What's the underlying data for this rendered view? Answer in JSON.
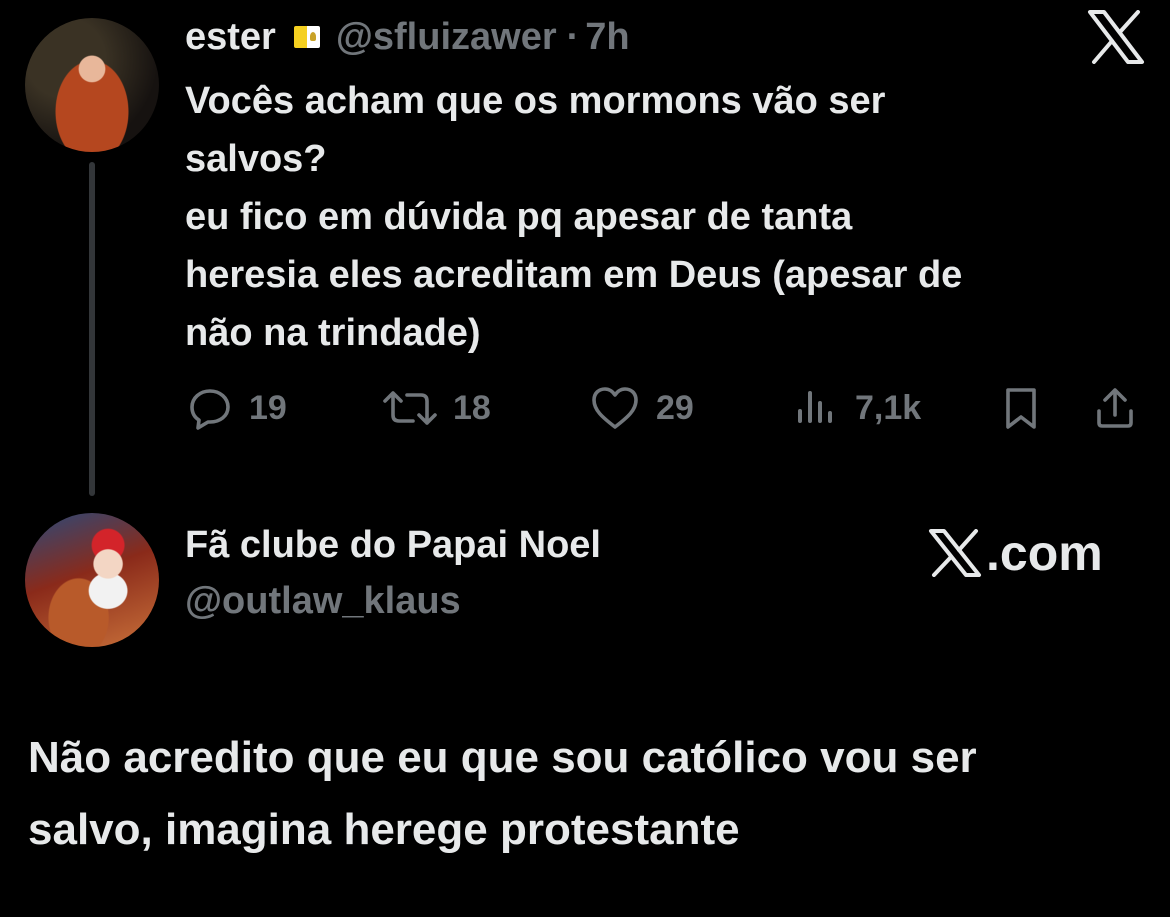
{
  "quoted_tweet": {
    "author": {
      "display_name": "ester",
      "badge_icon": "vatican-flag-icon",
      "handle": "@sfluizawer",
      "separator": "·",
      "time": "7h"
    },
    "text_lines": [
      "Vocês acham que os mormons vão ser",
      "salvos?",
      "eu fico em dúvida pq apesar de tanta",
      "heresia eles acreditam em Deus (apesar de",
      "não na trindade)"
    ],
    "actions": {
      "replies": "19",
      "reposts": "18",
      "likes": "29",
      "views": "7,1k"
    }
  },
  "reply_card": {
    "display_name": "Fã clube do Papai Noel",
    "handle": "@outlaw_klaus",
    "brand_label": ".com",
    "text_lines": [
      "Não acredito que eu que sou católico vou ser",
      "salvo, imagina herege protestante"
    ]
  },
  "colors": {
    "background": "#000000",
    "primary_text": "#e7e9ea",
    "secondary_text": "#71767b",
    "thread_line": "#333639"
  }
}
